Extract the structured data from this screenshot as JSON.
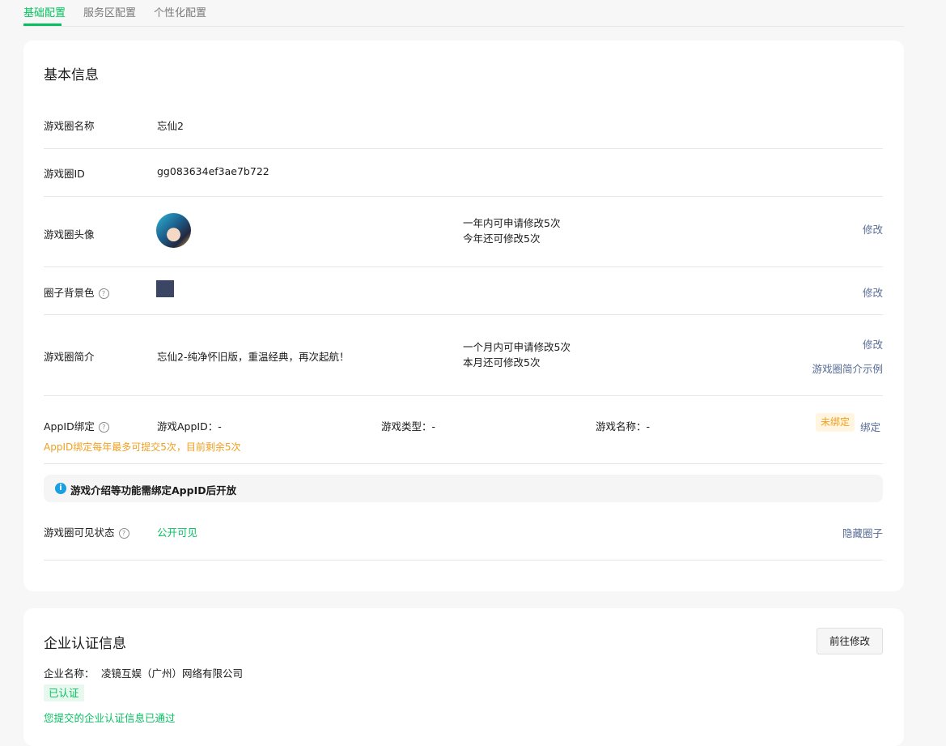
{
  "tabs": [
    {
      "label": "基础配置",
      "active": true
    },
    {
      "label": "服务区配置",
      "active": false
    },
    {
      "label": "个性化配置",
      "active": false
    }
  ],
  "basic_info": {
    "title": "基本信息",
    "name": {
      "label": "游戏圈名称",
      "value": "忘仙2"
    },
    "id": {
      "label": "游戏圈ID",
      "value": "gg083634ef3ae7b722"
    },
    "avatar": {
      "label": "游戏圈头像",
      "note_line1": "一年内可申请修改5次",
      "note_line2": "今年还可修改5次",
      "action": "修改"
    },
    "bg_color": {
      "label": "圈子背景色",
      "color": "#3a4664",
      "action": "修改"
    },
    "intro": {
      "label": "游戏圈简介",
      "value": "忘仙2-纯净怀旧版，重温经典，再次起航！",
      "note_line1": "一个月内可申请修改5次",
      "note_line2": "本月还可修改5次",
      "action": "修改",
      "example_link": "游戏圈简介示例"
    },
    "appid": {
      "label": "AppID绑定",
      "game_appid": "游戏AppID：-",
      "game_type": "游戏类型：-",
      "game_name": "游戏名称：-",
      "status": "未绑定",
      "action": "绑定",
      "warning": "AppID绑定每年最多可提交5次，目前剩余5次"
    },
    "info_bar": "游戏介绍等功能需绑定AppID后开放",
    "visibility": {
      "label": "游戏圈可见状态",
      "value": "公开可见",
      "action": "隐藏圈子"
    }
  },
  "enterprise": {
    "title": "企业认证信息",
    "edit_button": "前往修改",
    "name_label": "企业名称：",
    "name_value": "凌镜互娱（广州）网络有限公司",
    "status": "已认证",
    "message": "您提交的企业认证信息已通过"
  },
  "colors": {
    "accent": "#07c160",
    "link": "#576b95",
    "warning": "#f0a020"
  }
}
